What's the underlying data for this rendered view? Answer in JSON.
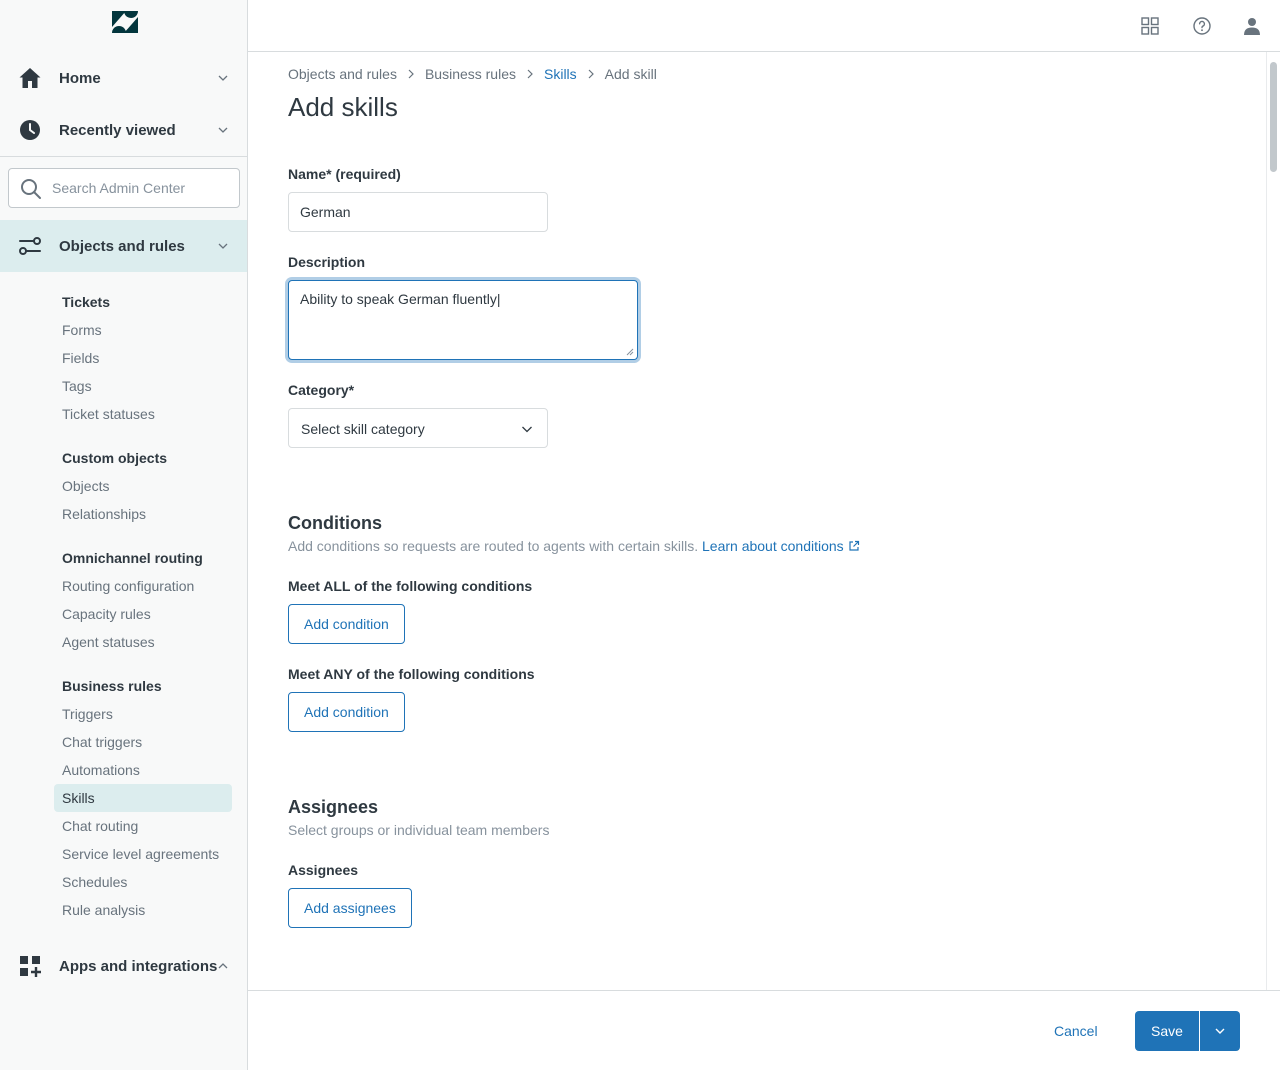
{
  "app": {
    "logo_icon": "zendesk-logo-icon",
    "accent": "#1f73b7",
    "selected_bg": "#dcedee"
  },
  "sidebar": {
    "home_label": "Home",
    "recent_label": "Recently viewed",
    "search_placeholder": "Search Admin Center",
    "objects_label": "Objects and rules",
    "apps_label": "Apps and integrations",
    "groups": [
      {
        "title": "Tickets",
        "items": [
          "Forms",
          "Fields",
          "Tags",
          "Ticket statuses"
        ]
      },
      {
        "title": "Custom objects",
        "items": [
          "Objects",
          "Relationships"
        ]
      },
      {
        "title": "Omnichannel routing",
        "items": [
          "Routing configuration",
          "Capacity rules",
          "Agent statuses"
        ]
      },
      {
        "title": "Business rules",
        "items": [
          "Triggers",
          "Chat triggers",
          "Automations",
          "Skills",
          "Chat routing",
          "Service level agreements",
          "Schedules",
          "Rule analysis"
        ]
      }
    ],
    "active_item": "Skills"
  },
  "header": {
    "icons": [
      "products-grid-icon",
      "help-icon",
      "user-profile-icon"
    ]
  },
  "breadcrumb": {
    "items": [
      "Objects and rules",
      "Business rules",
      "Skills",
      "Add skill"
    ]
  },
  "page": {
    "title": "Add skills"
  },
  "form": {
    "name_label": "Name* (required)",
    "name_value": "German",
    "description_label": "Description",
    "description_value": "Ability to speak German fluently|",
    "category_label": "Category*",
    "category_value": "Select skill category"
  },
  "conditions": {
    "title": "Conditions",
    "description": "Add conditions so requests are routed to agents with certain skills.",
    "learn_link": "Learn about conditions",
    "all_label": "Meet ALL of the following conditions",
    "any_label": "Meet ANY of the following conditions",
    "add_condition_label": "Add condition"
  },
  "assignees": {
    "title": "Assignees",
    "description": "Select groups or individual team members",
    "label": "Assignees",
    "add_label": "Add assignees"
  },
  "footer": {
    "cancel_label": "Cancel",
    "save_label": "Save"
  }
}
